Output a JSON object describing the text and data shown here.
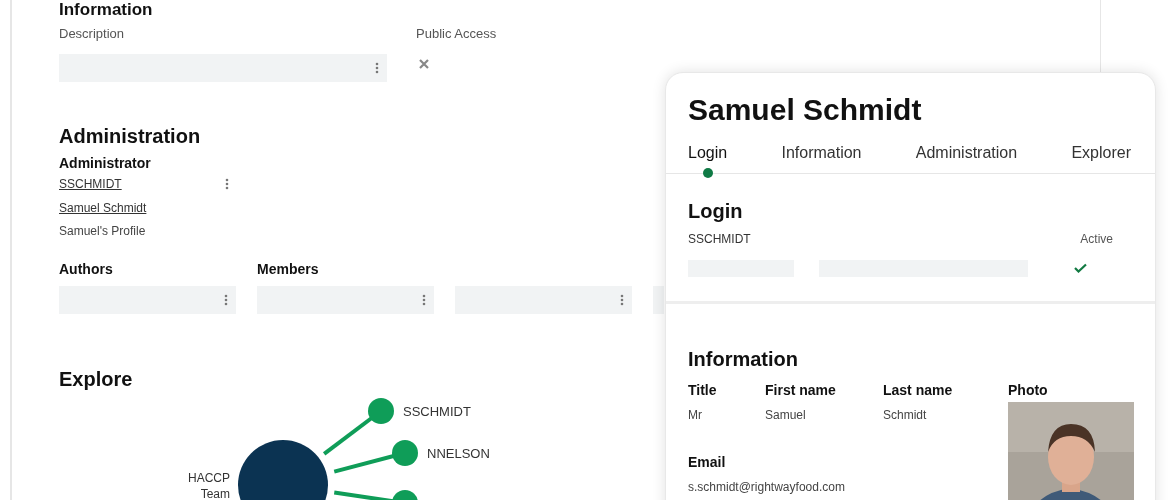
{
  "background": {
    "information": {
      "heading": "Information",
      "description_label": "Description",
      "public_access_label": "Public Access",
      "public_access": false
    },
    "administration": {
      "heading": "Administration",
      "administrator_label": "Administrator",
      "login": "SSCHMIDT",
      "name": "Samuel Schmidt",
      "profile": "Samuel's Profile",
      "authors_label": "Authors",
      "members_label": "Members"
    },
    "explore": {
      "heading": "Explore",
      "center": "HACCP Team",
      "nodes": [
        {
          "kind": "user",
          "label": "SSCHMIDT"
        },
        {
          "kind": "user",
          "label": "NNELSON"
        },
        {
          "kind": "user"
        }
      ]
    }
  },
  "card": {
    "title": "Samuel Schmidt",
    "tabs": [
      {
        "label": "Login",
        "selected": true
      },
      {
        "label": "Information",
        "selected": false
      },
      {
        "label": "Administration",
        "selected": false
      },
      {
        "label": "Explorer",
        "selected": false
      }
    ],
    "login": {
      "heading": "Login",
      "username": "SSCHMIDT",
      "active_label": "Active",
      "active": true
    },
    "information": {
      "heading": "Information",
      "fields": [
        {
          "label": "Title",
          "value": "Mr"
        },
        {
          "label": "First name",
          "value": "Samuel"
        },
        {
          "label": "Last name",
          "value": "Schmidt"
        }
      ],
      "photo_label": "Photo",
      "email_label": "Email",
      "email": "s.schmidt@rightwayfood.com"
    }
  }
}
